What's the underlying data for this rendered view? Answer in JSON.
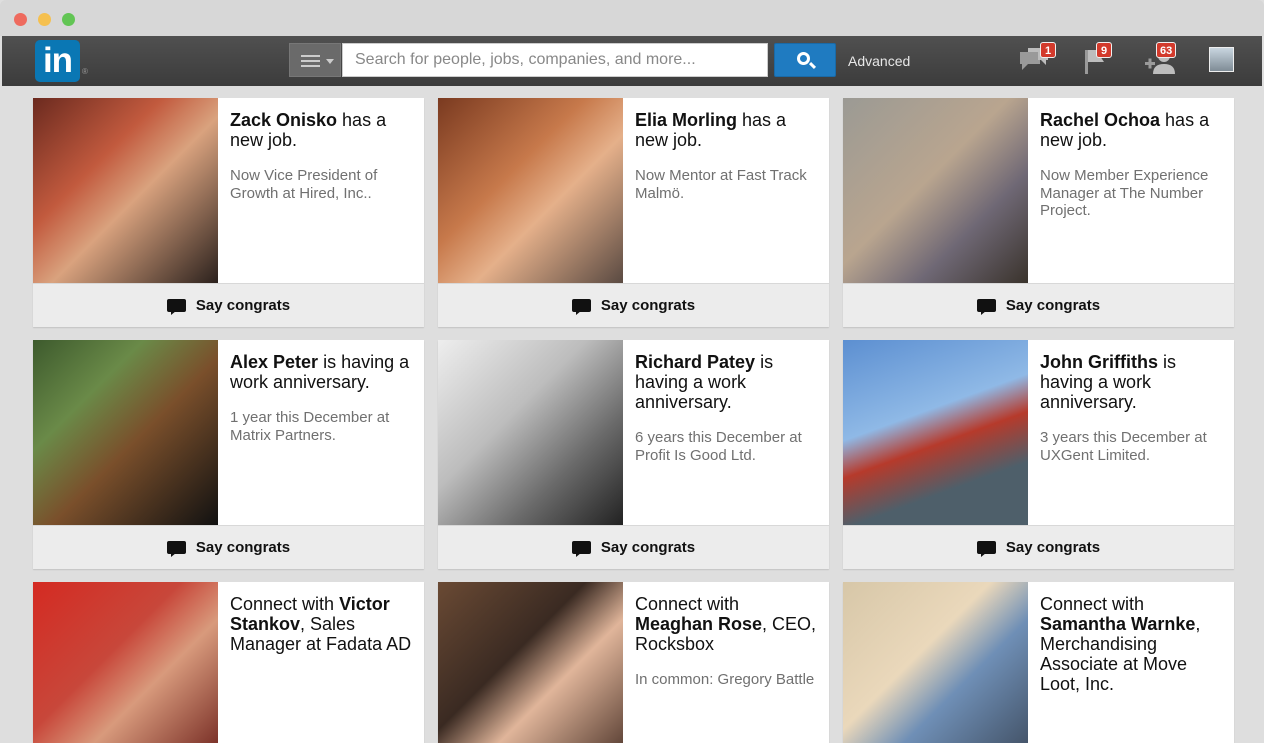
{
  "header": {
    "search_placeholder": "Search for people, jobs, companies, and more...",
    "advanced_label": "Advanced",
    "badges": {
      "messages": "1",
      "notifications": "9",
      "connections": "63"
    },
    "logo_text": "in",
    "logo_reg": "®"
  },
  "congrats_label": "Say congrats",
  "cards": [
    {
      "name": "Zack Onisko",
      "headline_rest": " has a new job.",
      "sub": "Now Vice President of Growth at Hired, Inc..",
      "photo": "linear-gradient(135deg,#6b2a1f,#c25a3e 35%,#d9a27e 55%,#2b211d)"
    },
    {
      "name": "Elia Morling",
      "headline_rest": " has a new job.",
      "sub": "Now Mentor at Fast Track Malmö.",
      "photo": "linear-gradient(135deg,#7a3a20,#c7794b 40%,#e5b08a 60%,#5a4a42)"
    },
    {
      "name": "Rachel Ochoa",
      "headline_rest": " has a new job.",
      "sub": "Now Member Experience Manager at The Number Project.",
      "photo": "linear-gradient(135deg,#9b9a94,#b9a58f 45%,#6f6875 70%,#3a332c)"
    },
    {
      "name": "Alex Peter",
      "headline_rest": " is having a work anniversary.",
      "sub": "1 year this December at Matrix Partners.",
      "photo": "linear-gradient(135deg,#3d5a2d,#6a8a48 30%,#7a4f2b 55%,#111)"
    },
    {
      "name": "Richard Patey",
      "headline_rest": " is having a work anniversary.",
      "sub": "6 years this December at Profit Is Good Ltd.",
      "photo": "linear-gradient(135deg,#eeeeee,#bdbdbd 40%,#6a6a6a 70%,#222)"
    },
    {
      "name": "John Griffiths",
      "headline_rest": " is having a work anniversary.",
      "sub": "3 years this December at UXGent Limited.",
      "photo": "linear-gradient(160deg,#5c8fd1,#8fb9e6 40%,#b63a2b 55%,#4e5f6a 75%)"
    }
  ],
  "connect_cards": [
    {
      "lead": "Connect with ",
      "name": "Victor Stankov",
      "rest": ", Sales Manager at Fadata AD",
      "sub": "",
      "photo": "linear-gradient(135deg,#d42a22,#c8473a 40%,#d89a7c 60%,#6b1f1a)"
    },
    {
      "lead": "Connect with ",
      "name": "Meaghan Rose",
      "rest": ", CEO, Rocksbox",
      "sub": "In common: Gregory Battle",
      "photo": "linear-gradient(135deg,#6a4a34,#3a2a22 40%,#e0b59a 60%,#4a3228)"
    },
    {
      "lead": "Connect with ",
      "name": "Samantha Warnke",
      "rest": ", Merchandising Associate at Move Loot, Inc.",
      "sub": "",
      "photo": "linear-gradient(135deg,#d7c7a8,#ead8bb 40%,#6f8fb6 60%,#3d4a5c)"
    }
  ]
}
